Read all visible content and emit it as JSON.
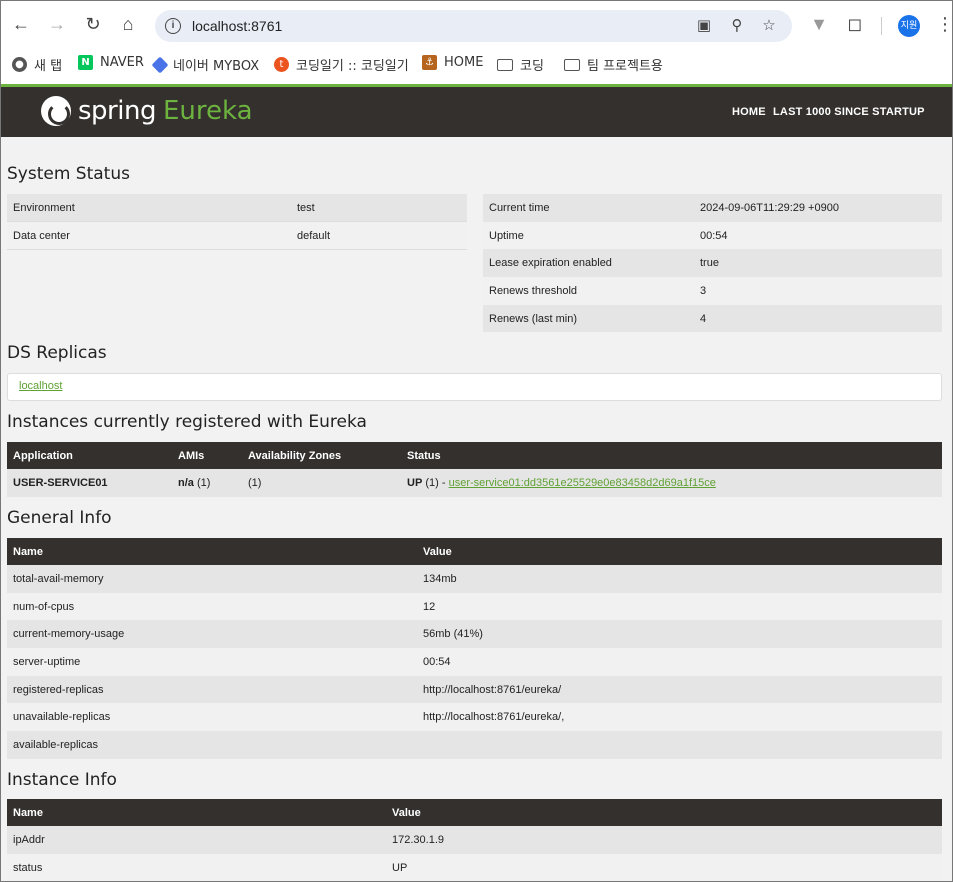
{
  "browser": {
    "url": "localhost:8761",
    "profile_label": "지원",
    "bookmarks": [
      {
        "label": "새 탭",
        "icon": "globe-icon"
      },
      {
        "label": "NAVER",
        "icon": "naver-icon"
      },
      {
        "label": "네이버 MYBOX",
        "icon": "mybox-icon"
      },
      {
        "label": "코딩일기 :: 코딩일기",
        "icon": "tistory-icon"
      },
      {
        "label": "HOME",
        "icon": "ship-icon"
      },
      {
        "label": "코딩",
        "icon": "folder-icon"
      },
      {
        "label": "팀 프로젝트용",
        "icon": "folder-icon"
      }
    ]
  },
  "header": {
    "logo_spring": "spring",
    "logo_eureka": "Eureka",
    "nav": [
      "HOME",
      "LAST 1000 SINCE STARTUP"
    ]
  },
  "system_status": {
    "title": "System Status",
    "left": [
      {
        "name": "Environment",
        "value": "test"
      },
      {
        "name": "Data center",
        "value": "default"
      }
    ],
    "right": [
      {
        "name": "Current time",
        "value": "2024-09-06T11:29:29 +0900"
      },
      {
        "name": "Uptime",
        "value": "00:54"
      },
      {
        "name": "Lease expiration enabled",
        "value": "true"
      },
      {
        "name": "Renews threshold",
        "value": "3"
      },
      {
        "name": "Renews (last min)",
        "value": "4"
      }
    ]
  },
  "ds_replicas": {
    "title": "DS Replicas",
    "items": [
      "localhost"
    ]
  },
  "instances": {
    "title": "Instances currently registered with Eureka",
    "headers": [
      "Application",
      "AMIs",
      "Availability Zones",
      "Status"
    ],
    "rows": [
      {
        "application": "USER-SERVICE01",
        "amis_bold": "n/a",
        "amis_count": "(1)",
        "zones": "(1)",
        "status_bold": "UP",
        "status_count": "(1) - ",
        "instance_link": "user-service01:dd3561e25529e0e83458d2d69a1f15ce"
      }
    ]
  },
  "general_info": {
    "title": "General Info",
    "headers": [
      "Name",
      "Value"
    ],
    "rows": [
      {
        "name": "total-avail-memory",
        "value": "134mb"
      },
      {
        "name": "num-of-cpus",
        "value": "12"
      },
      {
        "name": "current-memory-usage",
        "value": "56mb (41%)"
      },
      {
        "name": "server-uptime",
        "value": "00:54"
      },
      {
        "name": "registered-replicas",
        "value": "http://localhost:8761/eureka/"
      },
      {
        "name": "unavailable-replicas",
        "value": "http://localhost:8761/eureka/,"
      },
      {
        "name": "available-replicas",
        "value": ""
      }
    ]
  },
  "instance_info": {
    "title": "Instance Info",
    "headers": [
      "Name",
      "Value"
    ],
    "rows": [
      {
        "name": "ipAddr",
        "value": "172.30.1.9"
      },
      {
        "name": "status",
        "value": "UP"
      }
    ]
  }
}
